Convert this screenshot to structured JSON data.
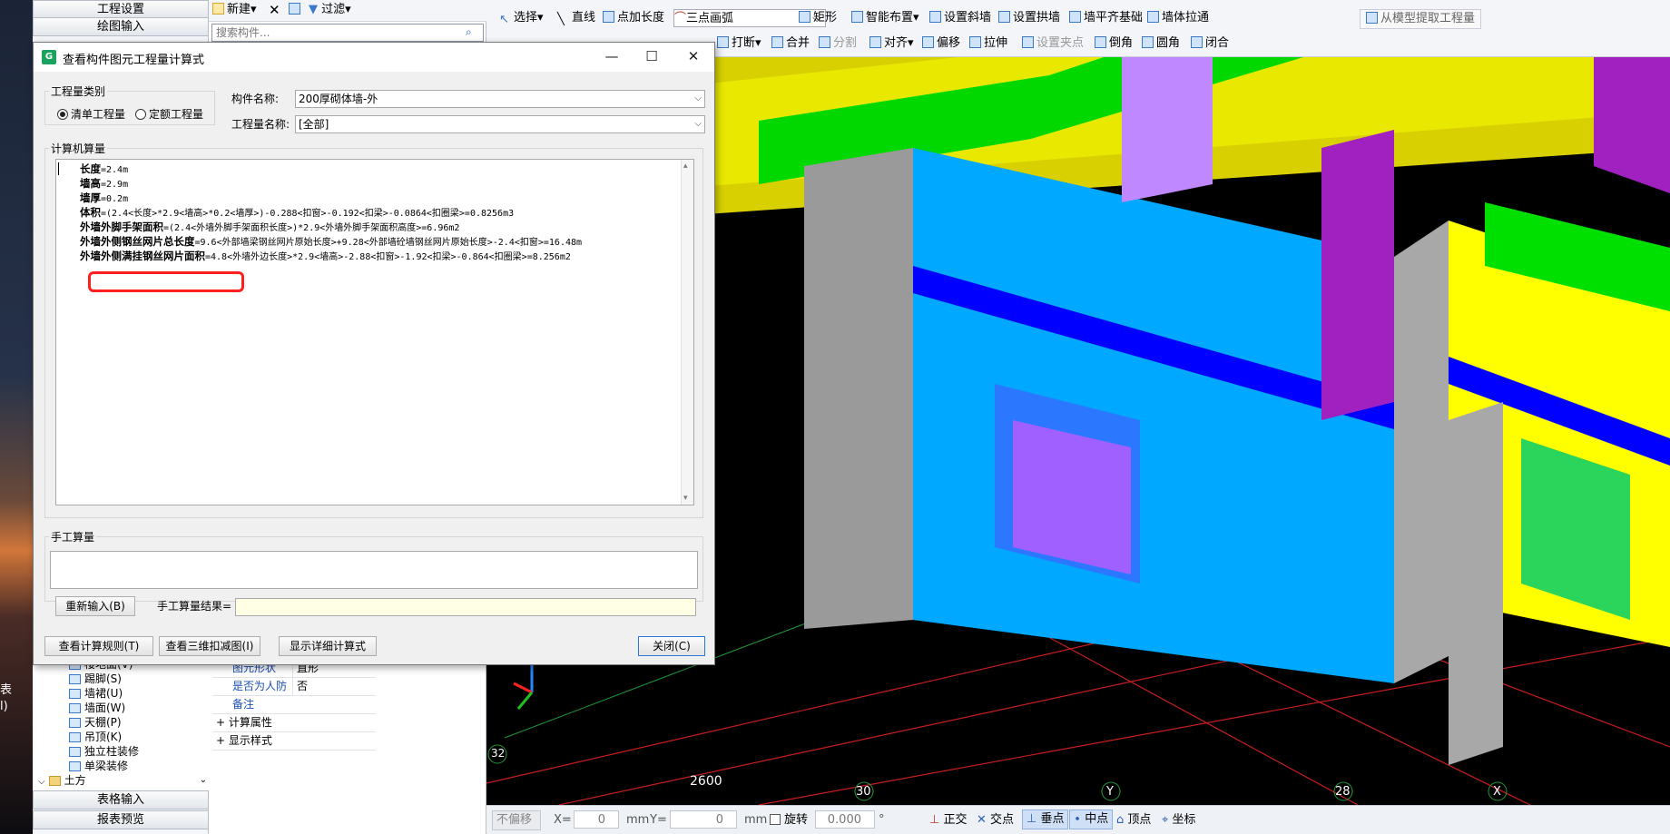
{
  "left_panel": {
    "nav_top": [
      "工程设置",
      "绘图输入"
    ],
    "tree": [
      {
        "label": "楼地面(V)",
        "indent": 1
      },
      {
        "label": "踢脚(S)",
        "indent": 1
      },
      {
        "label": "墙裙(U)",
        "indent": 1
      },
      {
        "label": "墙面(W)",
        "indent": 1
      },
      {
        "label": "天棚(P)",
        "indent": 1
      },
      {
        "label": "吊顶(K)",
        "indent": 1
      },
      {
        "label": "独立柱装修",
        "indent": 1
      },
      {
        "label": "单梁装修",
        "indent": 1
      },
      {
        "label": "土方",
        "indent": 0
      }
    ],
    "nav_bottom": [
      "表格输入",
      "报表预览"
    ]
  },
  "background_text": [
    "表",
    "l)"
  ],
  "props": {
    "toolbar": {
      "new": "新建",
      "filter": "过滤"
    },
    "search_placeholder": "搜索构件...",
    "rows": [
      {
        "k": "图元形状",
        "v": "直形"
      },
      {
        "k": "是否为人防",
        "v": "否"
      },
      {
        "k": "备注",
        "v": ""
      },
      {
        "k": "+ 计算属性",
        "v": ""
      },
      {
        "k": "+ 显示样式",
        "v": ""
      }
    ]
  },
  "ribbon": {
    "row1": [
      "选择",
      "直线",
      "点加长度",
      "三点画弧",
      "矩形",
      "智能布置",
      "设置斜墙",
      "设置拱墙",
      "墙平齐基础",
      "墙体拉通",
      "从模型提取工程量"
    ],
    "row2": [
      "打断",
      "合并",
      "分割",
      "对齐",
      "偏移",
      "拉伸",
      "设置夹点",
      "倒角",
      "圆角",
      "闭合"
    ]
  },
  "dialog": {
    "title": "查看构件图元工程量计算式",
    "type_group": "工程量类别",
    "radio_list": "清单工程量",
    "radio_quota": "定额工程量",
    "component_label": "构件名称:",
    "component_value": "200厚砌体墙-外",
    "quantity_label": "工程量名称:",
    "quantity_value": "[全部]",
    "computed_group": "计算机算量",
    "lines": [
      {
        "name": "长度",
        "expr": "=2.4m"
      },
      {
        "name": "墙高",
        "expr": "=2.9m"
      },
      {
        "name": "墙厚",
        "expr": "=0.2m"
      },
      {
        "name": "体积",
        "expr": "=(2.4<长度>*2.9<墙高>*0.2<墙厚>)-0.288<扣窗>-0.192<扣梁>-0.0864<扣圈梁>=0.8256m3"
      },
      {
        "name": "外墙外脚手架面积",
        "expr": "=(2.4<外墙外脚手架面积长度>)*2.9<外墙外脚手架面积高度>=6.96m2"
      },
      {
        "name": "外墙外侧钢丝网片总长度",
        "expr": "=9.6<外部墙梁钢丝网片原始长度>+9.28<外部墙砼墙钢丝网片原始长度>-2.4<扣窗>=16.48m"
      },
      {
        "name": "外墙外侧满挂钢丝网片面积",
        "expr": "=4.8<外墙外边长度>*2.9<墙高>-2.88<扣窗>-1.92<扣梁>-0.864<扣圈梁>=8.256m2"
      }
    ],
    "manual_group": "手工算量",
    "reenter_button": "重新输入(B)",
    "manual_result_label": "手工算量结果=",
    "btn_rules": "查看计算规则(T)",
    "btn_3d": "查看三维扣减图(I)",
    "btn_detail": "显示详细计算式",
    "btn_close": "关闭(C)"
  },
  "viewport": {
    "labels": [
      "32",
      "2600",
      "30",
      "Y",
      "28",
      "X"
    ]
  },
  "status": {
    "offset": "不偏移",
    "x_label": "X=",
    "x_value": "0",
    "unit_mm": "mm",
    "y_label": "Y=",
    "y_value": "0",
    "rotate": "旋转",
    "rotate_value": "0.000",
    "deg": "°",
    "snaps": [
      "正交",
      "交点",
      "垂点",
      "中点",
      "顶点",
      "坐标"
    ]
  }
}
